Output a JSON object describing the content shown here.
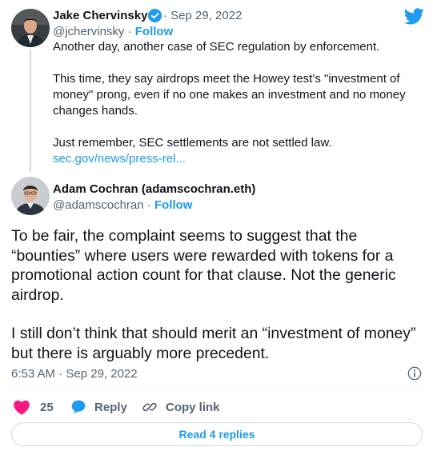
{
  "parent": {
    "name": "Jake Chervinsky",
    "handle": "@jchervinsky",
    "follow": "Follow",
    "date": "Sep 29, 2022",
    "paragraphs": [
      "Another day, another case of SEC regulation by enforcement.",
      "This time, they say airdrops meet the Howey test’s \"investment of money\" prong, even if no one makes an investment and no money changes hands.",
      "Just remember, SEC settlements are not settled law."
    ],
    "link": "sec.gov/news/press-rel..."
  },
  "tweet": {
    "name": "Adam Cochran (adamscochran.eth)",
    "handle": "@adamscochran",
    "follow": "Follow",
    "paragraphs": [
      "To be fair, the complaint seems to suggest that the “bounties” where users were rewarded with tokens for a promotional action count for that clause. Not the generic airdrop.",
      "I still don’t think that should merit an “investment of money” but there is arguably more precedent."
    ],
    "timestamp": "6:53 AM · Sep 29, 2022"
  },
  "actions": {
    "likes": "25",
    "reply": "Reply",
    "copy_link": "Copy link",
    "read_replies": "Read 4 replies"
  },
  "colors": {
    "accent": "#1d9bf0",
    "heart": "#f91880",
    "secondary_text": "#536471"
  },
  "icons": [
    "twitter-bird-icon",
    "verified-badge-icon",
    "info-icon",
    "heart-icon",
    "reply-bubble-icon",
    "link-icon"
  ]
}
